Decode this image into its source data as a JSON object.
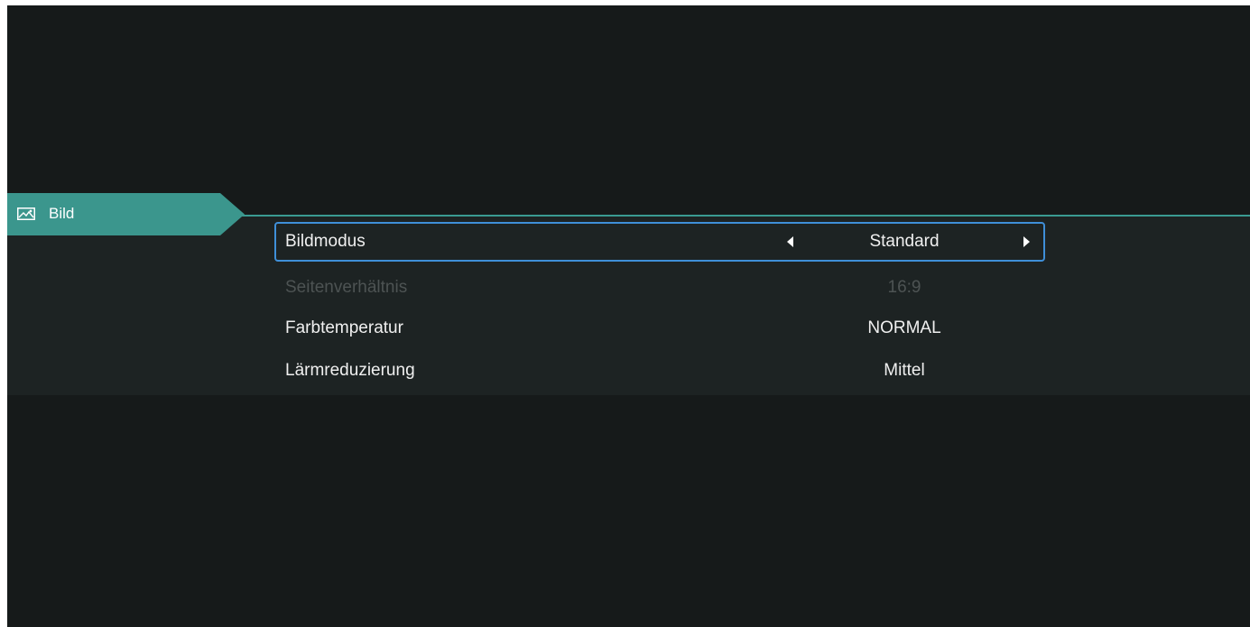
{
  "tab": {
    "label": "Bild",
    "icon": "picture-icon"
  },
  "colors": {
    "accent": "#3b968d",
    "selection_border": "#3f8fd8",
    "background": "#161a1a",
    "panel": "#1d2323",
    "disabled_text": "#4d5353"
  },
  "menu": {
    "items": [
      {
        "label": "Bildmodus",
        "value": "Standard",
        "selected": true,
        "disabled": false
      },
      {
        "label": "Seitenverhältnis",
        "value": "16:9",
        "selected": false,
        "disabled": true
      },
      {
        "label": "Farbtemperatur",
        "value": "NORMAL",
        "selected": false,
        "disabled": false
      },
      {
        "label": "Lärmreduzierung",
        "value": "Mittel",
        "selected": false,
        "disabled": false
      }
    ]
  }
}
